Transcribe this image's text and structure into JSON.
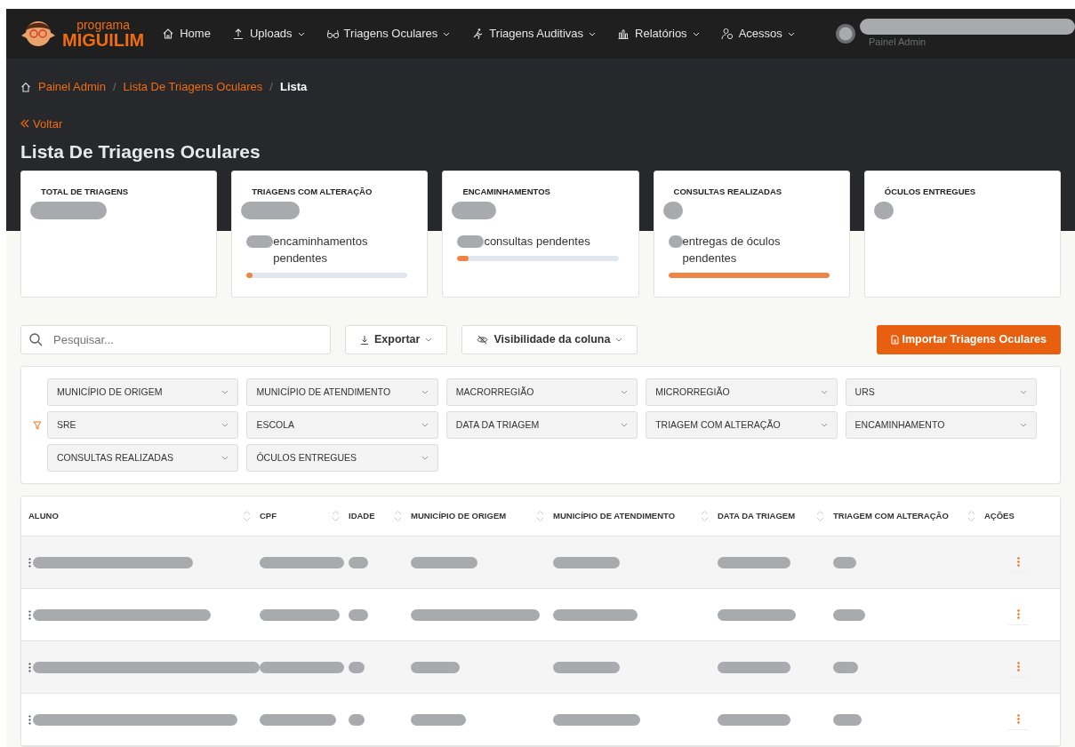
{
  "navbar": {
    "brand": {
      "line1": "programa",
      "line2": "MIGUILIM"
    },
    "items": [
      {
        "label": "Home",
        "dropdown": false
      },
      {
        "label": "Uploads",
        "dropdown": true
      },
      {
        "label": "Triagens Oculares",
        "dropdown": true
      },
      {
        "label": "Triagens Auditivas",
        "dropdown": true
      },
      {
        "label": "Relatórios",
        "dropdown": true
      },
      {
        "label": "Acessos",
        "dropdown": true
      }
    ],
    "user": {
      "role": "Painel Admin"
    }
  },
  "breadcrumb": [
    {
      "label": "Painel Admin",
      "kind": "link"
    },
    {
      "label": "/",
      "kind": "separator"
    },
    {
      "label": "Lista De Triagens Oculares",
      "kind": "link"
    },
    {
      "label": "/",
      "kind": "separator"
    },
    {
      "label": "Lista",
      "kind": "current"
    }
  ],
  "back": "Voltar",
  "title": "Lista De Triagens Oculares",
  "stats": [
    {
      "label": "TOTAL DE TRIAGENS"
    },
    {
      "label": "TRIAGENS COM ALTERAÇÃO",
      "pending": {
        "text": "encaminhamentos pendentes",
        "level": 0.04
      }
    },
    {
      "label": "ENCAMINHAMENTOS",
      "pending": {
        "text": "consultas pendentes",
        "level": 0.07
      }
    },
    {
      "label": "CONSULTAS REALIZADAS",
      "pending": {
        "text": "entregas de óculos pendentes",
        "level": 1.0
      }
    },
    {
      "label": "ÓCULOS ENTREGUES"
    }
  ],
  "toolbar": {
    "search": {
      "placeholder": "Pesquisar..."
    },
    "export": "Exportar",
    "visibility": "Visibilidade da coluna",
    "import": "Importar Triagens Oculares"
  },
  "filters": [
    "MUNICÍPIO DE ORIGEM",
    "MUNICÍPIO DE ATENDIMENTO",
    "MACRORREGIÃO",
    "MICRORREGIÃO",
    "URS",
    "SRE",
    "ESCOLA",
    "DATA DA TRIAGEM",
    "TRIAGEM COM ALTERAÇÃO",
    "ENCAMINHAMENTO",
    "CONSULTAS REALIZADAS",
    "ÓCULOS ENTREGUES"
  ],
  "table": {
    "columns": [
      {
        "label": "ALUNO",
        "sortable": true
      },
      {
        "label": "CPF",
        "sortable": true
      },
      {
        "label": "IDADE",
        "sortable": true
      },
      {
        "label": "MUNICÍPIO DE ORIGEM",
        "sortable": true
      },
      {
        "label": "MUNICÍPIO DE ATENDIMENTO",
        "sortable": true
      },
      {
        "label": "DATA DA TRIAGEM",
        "sortable": true
      },
      {
        "label": "TRIAGEM COM ALTERAÇÃO",
        "sortable": true
      },
      {
        "label": "AÇÕES",
        "sortable": false
      }
    ],
    "rows": [
      {
        "kind": "redacted"
      },
      {
        "kind": "redacted"
      },
      {
        "kind": "redacted"
      },
      {
        "kind": "redacted"
      }
    ]
  }
}
